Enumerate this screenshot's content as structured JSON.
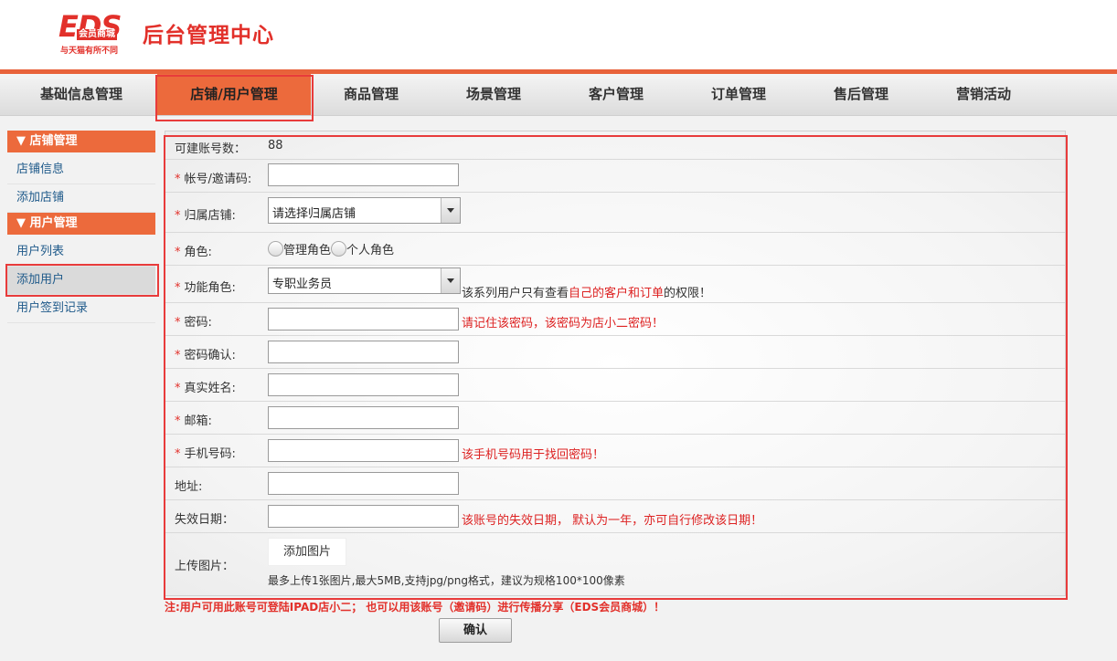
{
  "header": {
    "logo_mark": "EDS",
    "logo_member": "会员商城",
    "logo_slogan": "与天猫有所不同",
    "site_title": "后台管理中心"
  },
  "nav": {
    "tabs": [
      {
        "label": "基础信息管理"
      },
      {
        "label": "店铺/用户管理",
        "active": true
      },
      {
        "label": "商品管理"
      },
      {
        "label": "场景管理"
      },
      {
        "label": "客户管理"
      },
      {
        "label": "订单管理"
      },
      {
        "label": "售后管理"
      },
      {
        "label": "营销活动"
      }
    ]
  },
  "sidebar": {
    "store_section": "▼ 店铺管理",
    "store_items": [
      "店铺信息",
      "添加店铺"
    ],
    "user_section": "▼ 用户管理",
    "user_items": [
      "用户列表",
      "添加用户",
      "用户签到记录"
    ],
    "active_item": "添加用户"
  },
  "form": {
    "account_quota_label": "可建账号数：",
    "account_quota_value": "88",
    "account_label": "帐号/邀请码:",
    "store_label": "归属店铺:",
    "store_select_value": "请选择归属店铺",
    "role_label": "角色:",
    "role_options": [
      "管理角色",
      "个人角色"
    ],
    "function_role_label": "功能角色:",
    "function_role_value": "专职业务员",
    "function_role_hint_pre": "该系列用户只有查看",
    "function_role_hint_red": "自己的客户和订单",
    "function_role_hint_post": "的权限！",
    "password_label": "密码:",
    "password_hint": "请记住该密码，该密码为店小二密码！",
    "password_confirm_label": "密码确认:",
    "real_name_label": "真实姓名:",
    "email_label": "邮箱:",
    "phone_label": "手机号码:",
    "phone_hint": "该手机号码用于找回密码！",
    "address_label": "地址:",
    "expire_label": "失效日期：",
    "expire_hint": "该账号的失效日期， 默认为一年，亦可自行修改该日期！",
    "upload_label": "上传图片：",
    "upload_button": "添加图片",
    "upload_note": "最多上传1张图片,最大5MB,支持jpg/png格式，建议为规格100*100像素",
    "required_mark": "*"
  },
  "footer_note": "注:用户可用此账号可登陆IPAD店小二； 也可以用该账号（邀请码）进行传播分享（EDS会员商城）！",
  "confirm_button": "确认",
  "colors": {
    "brand": "#e2302a",
    "accent": "#ec6a3c",
    "highlight_box": "#e83b3b"
  }
}
